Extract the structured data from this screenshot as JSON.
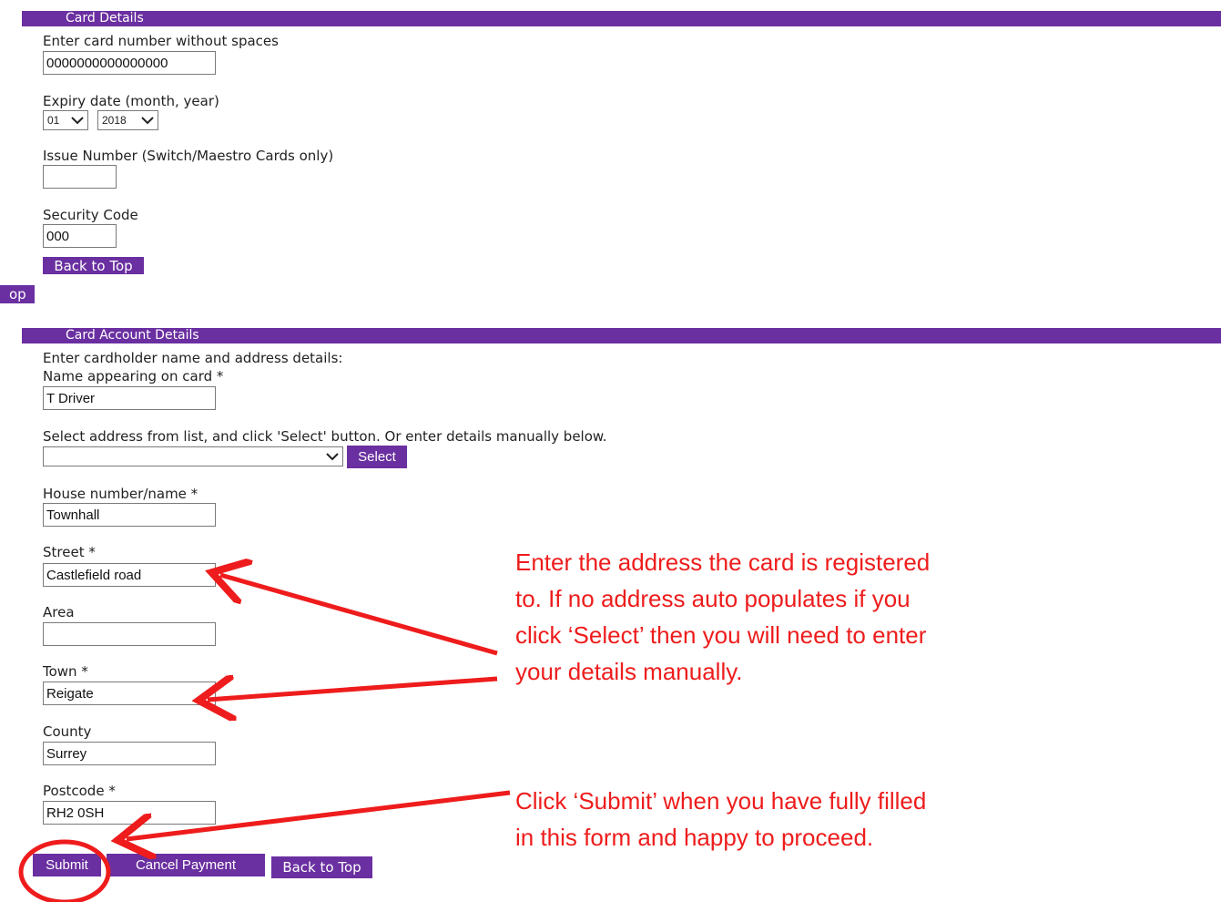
{
  "card_details": {
    "section_title": "Card Details",
    "card_number_label": "Enter card number without spaces",
    "card_number_value": "0000000000000000",
    "expiry_label": "Expiry date (month, year)",
    "expiry_month": "01",
    "expiry_year": "2018",
    "issue_number_label": "Issue Number (Switch/Maestro Cards only)",
    "issue_number_value": "",
    "security_code_label": "Security Code",
    "security_code_value": "000",
    "back_to_top_label": "Back to Top"
  },
  "partial_left_button": "op",
  "card_account": {
    "section_title": "Card Account Details",
    "intro": "Enter cardholder name and address details:",
    "name_label": "Name appearing on card *",
    "name_value": "T Driver",
    "address_select_label": "Select address from list, and click 'Select' button. Or enter details manually below.",
    "address_select_value": "",
    "select_button_label": "Select",
    "house_label": "House number/name *",
    "house_value": "Townhall",
    "street_label": "Street *",
    "street_value": "Castlefield road",
    "area_label": "Area",
    "area_value": "",
    "town_label": "Town *",
    "town_value": "Reigate",
    "county_label": "County",
    "county_value": "Surrey",
    "postcode_label": "Postcode *",
    "postcode_value": "RH2 0SH",
    "submit_label": "Submit",
    "cancel_label": "Cancel Payment",
    "back_to_top_label": "Back to Top"
  },
  "annotations": {
    "address_note_lines": [
      "Enter the address the card is registered",
      "to. If no address auto populates if you",
      "click ‘Select’ then you will need to enter",
      "your details manually."
    ],
    "submit_note_lines": [
      "Click ‘Submit’ when you have fully filled",
      "in this form and happy to proceed."
    ]
  },
  "colors": {
    "accent_purple": "#6a2fa0",
    "annotation_red": "#ee1c1c"
  },
  "icons": {
    "dropdown": "chevron-down-icon"
  }
}
